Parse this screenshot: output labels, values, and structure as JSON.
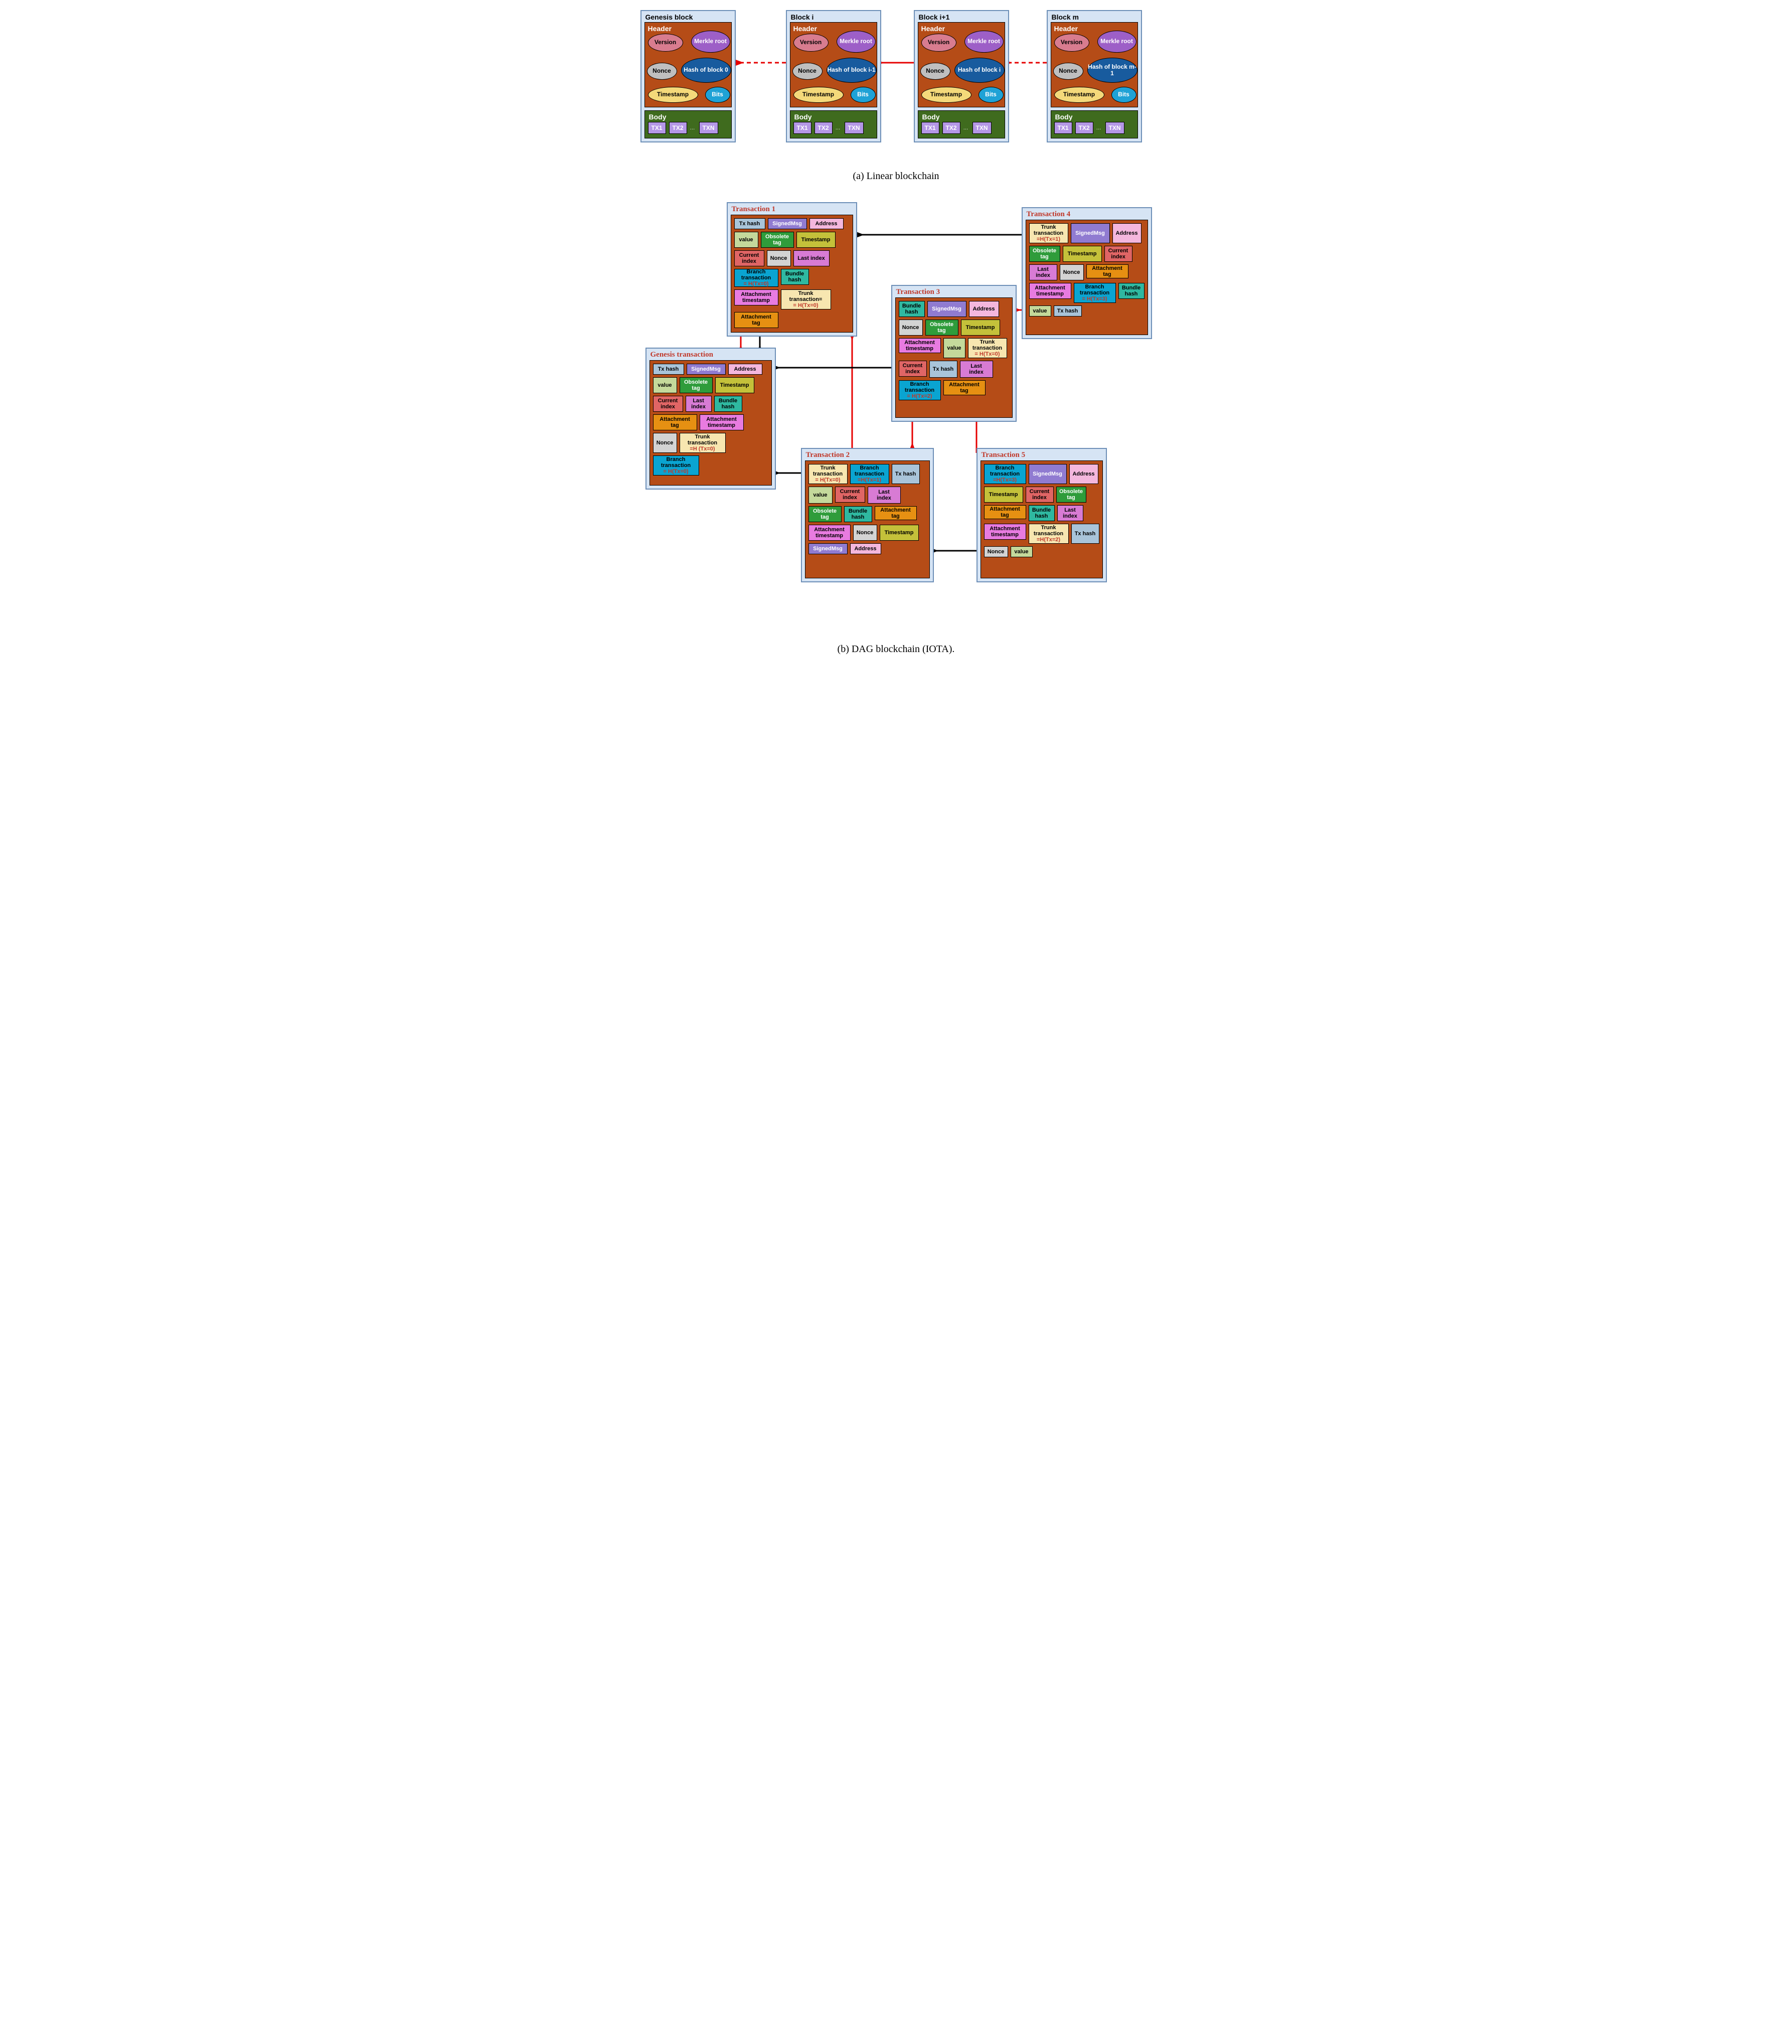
{
  "captions": {
    "a": "(a) Linear blockchain",
    "b": "(b) DAG blockchain (IOTA)."
  },
  "linearBlocks": [
    {
      "title": "Genesis block",
      "hashLabel": "Hash of block 0"
    },
    {
      "title": "Block i",
      "hashLabel": "Hash of block i-1"
    },
    {
      "title": "Block i+1",
      "hashLabel": "Hash of block i"
    },
    {
      "title": "Block m",
      "hashLabel": "Hash of block m-1"
    }
  ],
  "headerCommon": {
    "headerLabel": "Header",
    "bodyLabel": "Body",
    "version": "Version",
    "merkle": "Merkle root",
    "nonce": "Nonce",
    "timestamp": "Timestamp",
    "bits": "Bits",
    "txs": [
      "TX1",
      "TX2",
      "…",
      "TXN"
    ]
  },
  "dagFields": {
    "txhash": "Tx hash",
    "signed": "SignedMsg",
    "address": "Address",
    "value": "value",
    "obs": "Obsolete tag",
    "timestamp": "Timestamp",
    "curidx": "Current index",
    "nonce": "Nonce",
    "lastidx": "Last index",
    "bundle": "Bundle hash",
    "attts": "Attachment timestamp",
    "atttag": "Attachment tag",
    "branchPrefix": "Branch transaction",
    "trunkPrefix": "Trunk transaction"
  },
  "dagTx": {
    "genesis": {
      "title": "Genesis transaction",
      "trunk": "=H (Tx=0)",
      "branch": "= H(Tx=0)"
    },
    "t1": {
      "title": "Transaction 1",
      "branch": "= H(Tx=0)",
      "trunk": "= H(Tx=0)"
    },
    "t2": {
      "title": "Transaction 2",
      "trunk": "= H(Tx=0)",
      "branch": "=H(Tx=1)"
    },
    "t3": {
      "title": "Transaction 3",
      "trunk": "= H(Tx=0)",
      "branch": "= H(Tx=2)"
    },
    "t4": {
      "title": "Transaction 4",
      "trunk": "=H(Tx=1)",
      "branch": "= H(Tx=3)"
    },
    "t5": {
      "title": "Transaction 5",
      "branch": "=H(Tx=3)",
      "trunk": "=H(Tx=2)"
    }
  }
}
